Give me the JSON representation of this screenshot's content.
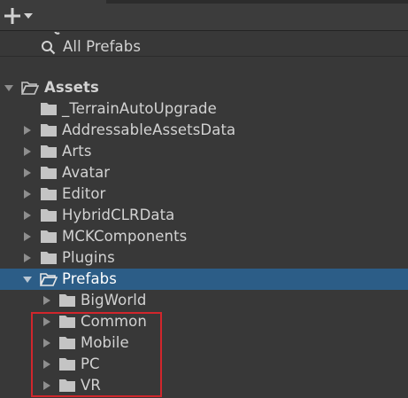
{
  "toolbar": {
    "add_icon": "plus-icon",
    "dropdown_icon": "triangle-down-icon"
  },
  "favorites": {
    "search_label": "All Prefabs",
    "search_icon": "search-icon"
  },
  "tree": {
    "root_label": "Assets",
    "items": [
      {
        "label": "_TerrainAutoUpgrade"
      },
      {
        "label": "AddressableAssetsData"
      },
      {
        "label": "Arts"
      },
      {
        "label": "Avatar"
      },
      {
        "label": "Editor"
      },
      {
        "label": "HybridCLRData"
      },
      {
        "label": "MCKComponents"
      },
      {
        "label": "Plugins"
      },
      {
        "label": "Prefabs"
      }
    ],
    "prefabs_children": [
      {
        "label": "BigWorld"
      },
      {
        "label": "Common"
      },
      {
        "label": "Mobile"
      },
      {
        "label": "PC"
      },
      {
        "label": "VR"
      }
    ]
  },
  "colors": {
    "background": "#383838",
    "selection": "#2c5d87",
    "highlight_box": "#d1262c",
    "folder": "#c4c4c4"
  }
}
